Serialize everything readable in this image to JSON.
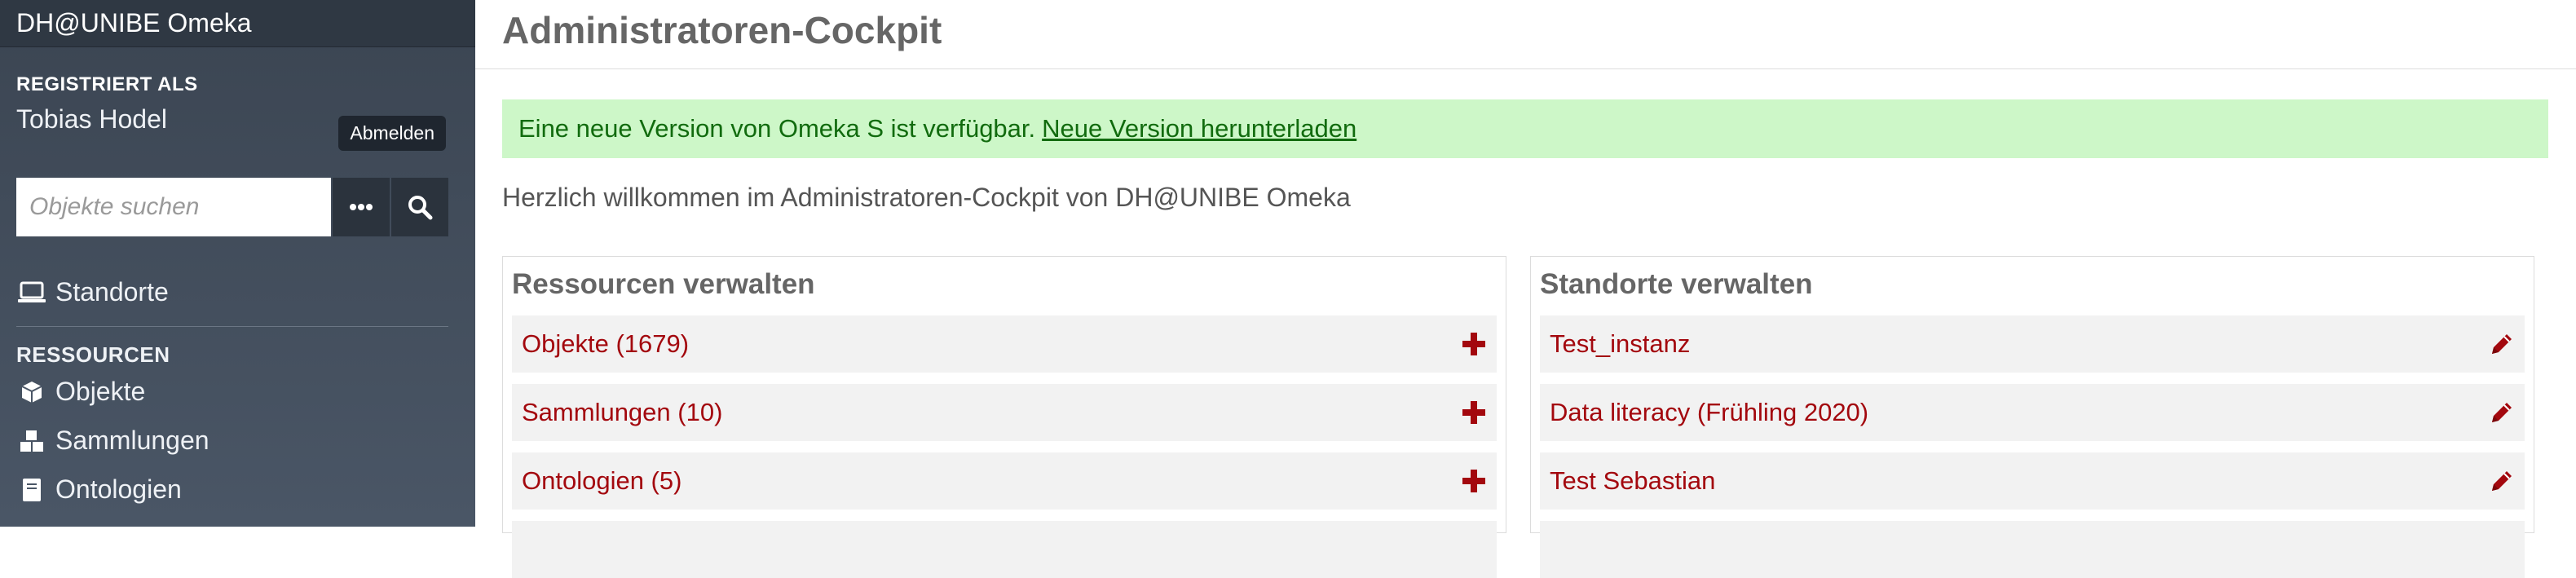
{
  "app": {
    "brand": "DH@UNIBE Omeka"
  },
  "user": {
    "registered_label": "REGISTRIERT ALS",
    "name": "Tobias Hodel",
    "logout_label": "Abmelden"
  },
  "search": {
    "placeholder": "Objekte suchen",
    "more_icon": "ellipsis-icon",
    "search_icon": "search-icon"
  },
  "sidebar": {
    "standorte_label": "Standorte",
    "section_resources": "RESSOURCEN",
    "items": [
      {
        "label": "Objekte",
        "icon": "cube-icon"
      },
      {
        "label": "Sammlungen",
        "icon": "cubes-icon"
      },
      {
        "label": "Ontologien",
        "icon": "book-icon"
      }
    ]
  },
  "main": {
    "title": "Administratoren-Cockpit",
    "alert_text": "Eine neue Version von Omeka S ist verfügbar.",
    "alert_link": "Neue Version herunterladen",
    "welcome": "Herzlich willkommen im Administratoren-Cockpit von DH@UNIBE Omeka",
    "resources_panel": {
      "title": "Ressourcen verwalten",
      "rows": [
        {
          "label": "Objekte (1679)",
          "icon": "plus-icon"
        },
        {
          "label": "Sammlungen (10)",
          "icon": "plus-icon"
        },
        {
          "label": "Ontologien (5)",
          "icon": "plus-icon"
        }
      ]
    },
    "sites_panel": {
      "title": "Standorte verwalten",
      "rows": [
        {
          "label": "Test_instanz",
          "icon": "pencil-icon"
        },
        {
          "label": "Data literacy (Frühling 2020)",
          "icon": "pencil-icon"
        },
        {
          "label": "Test Sebastian",
          "icon": "pencil-icon"
        }
      ]
    }
  },
  "colors": {
    "sidebar": "#3b4552",
    "accent_red": "#a3080e",
    "alert_bg": "#cdf7c8",
    "alert_text": "#116b0e"
  }
}
